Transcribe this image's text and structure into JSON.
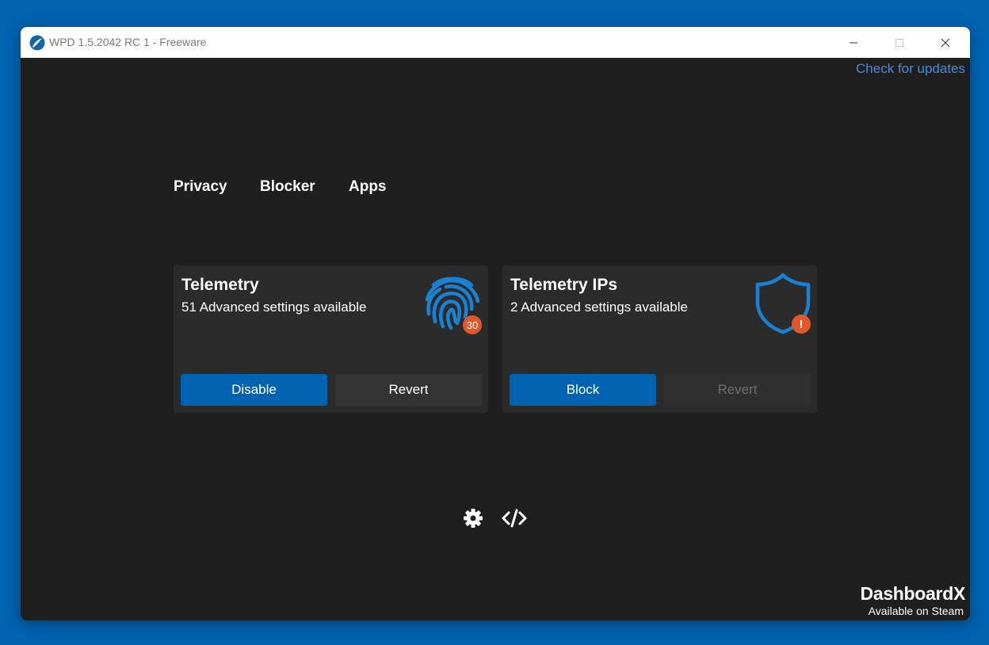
{
  "window": {
    "title": "WPD 1.5.2042 RC 1 - Freeware",
    "controls": {
      "minimize": "minimize-icon",
      "maximize": "maximize-icon",
      "close": "close-icon"
    }
  },
  "header": {
    "update_link": "Check for updates"
  },
  "tabs": [
    {
      "label": "Privacy"
    },
    {
      "label": "Blocker"
    },
    {
      "label": "Apps"
    }
  ],
  "cards": [
    {
      "title": "Telemetry",
      "subtitle": "51 Advanced settings available",
      "icon": "fingerprint-icon",
      "badge": "30",
      "primary_button": "Disable",
      "secondary_button": "Revert",
      "secondary_enabled": true
    },
    {
      "title": "Telemetry IPs",
      "subtitle": "2 Advanced settings available",
      "icon": "shield-icon",
      "badge": "!",
      "primary_button": "Block",
      "secondary_button": "Revert",
      "secondary_enabled": false
    }
  ],
  "footer": {
    "icons": [
      "gear-icon",
      "code-icon"
    ]
  },
  "promo": {
    "title": "DashboardX",
    "subtitle": "Available on Steam"
  },
  "colors": {
    "accent": "#0063b1",
    "link": "#3d8ee8",
    "badge": "#e2562b",
    "icon_blue": "#1a82d4",
    "background": "#1f1f1f",
    "card": "#2b2b2b"
  }
}
